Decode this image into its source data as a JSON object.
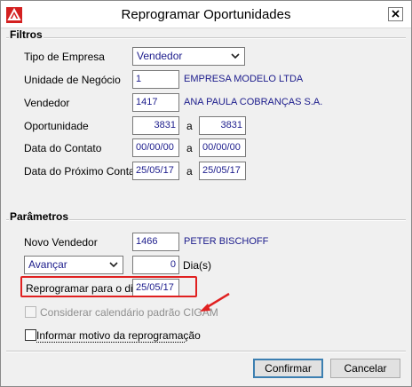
{
  "window": {
    "title": "Reprogramar Oportunidades"
  },
  "filtros": {
    "title": "Filtros",
    "tipo_empresa": {
      "label": "Tipo de Empresa",
      "value": "Vendedor"
    },
    "unidade_negocio": {
      "label": "Unidade de Negócio",
      "code": "1",
      "name": "EMPRESA MODELO LTDA"
    },
    "vendedor": {
      "label": "Vendedor",
      "code": "1417",
      "name": "ANA PAULA COBRANÇAS S.A."
    },
    "oportunidade": {
      "label": "Oportunidade",
      "from": "3831",
      "sep": "a",
      "to": "3831"
    },
    "data_contato": {
      "label": "Data do Contato",
      "from": "00/00/00",
      "sep": "a",
      "to": "00/00/00"
    },
    "data_proximo": {
      "label": "Data do Próximo Contato",
      "from": "25/05/17",
      "sep": "a",
      "to": "25/05/17"
    }
  },
  "parametros": {
    "title": "Parâmetros",
    "novo_vendedor": {
      "label": "Novo Vendedor",
      "code": "1466",
      "name": "PETER BISCHOFF"
    },
    "acao": {
      "value": "Avançar"
    },
    "dias": {
      "value": "0",
      "label": "Dia(s)"
    },
    "reprogramar": {
      "label": "Reprogramar para o dia",
      "value": "25/05/17"
    },
    "calendario": {
      "label": "Considerar calendário padrão CIGAM",
      "checked": false
    },
    "motivo": {
      "label": "Informar motivo da reprogramação",
      "checked": false
    }
  },
  "buttons": {
    "confirm": "Confirmar",
    "cancel": "Cancelar"
  },
  "colors": {
    "highlight": "#e02020",
    "value_text": "#1c1c8c"
  }
}
